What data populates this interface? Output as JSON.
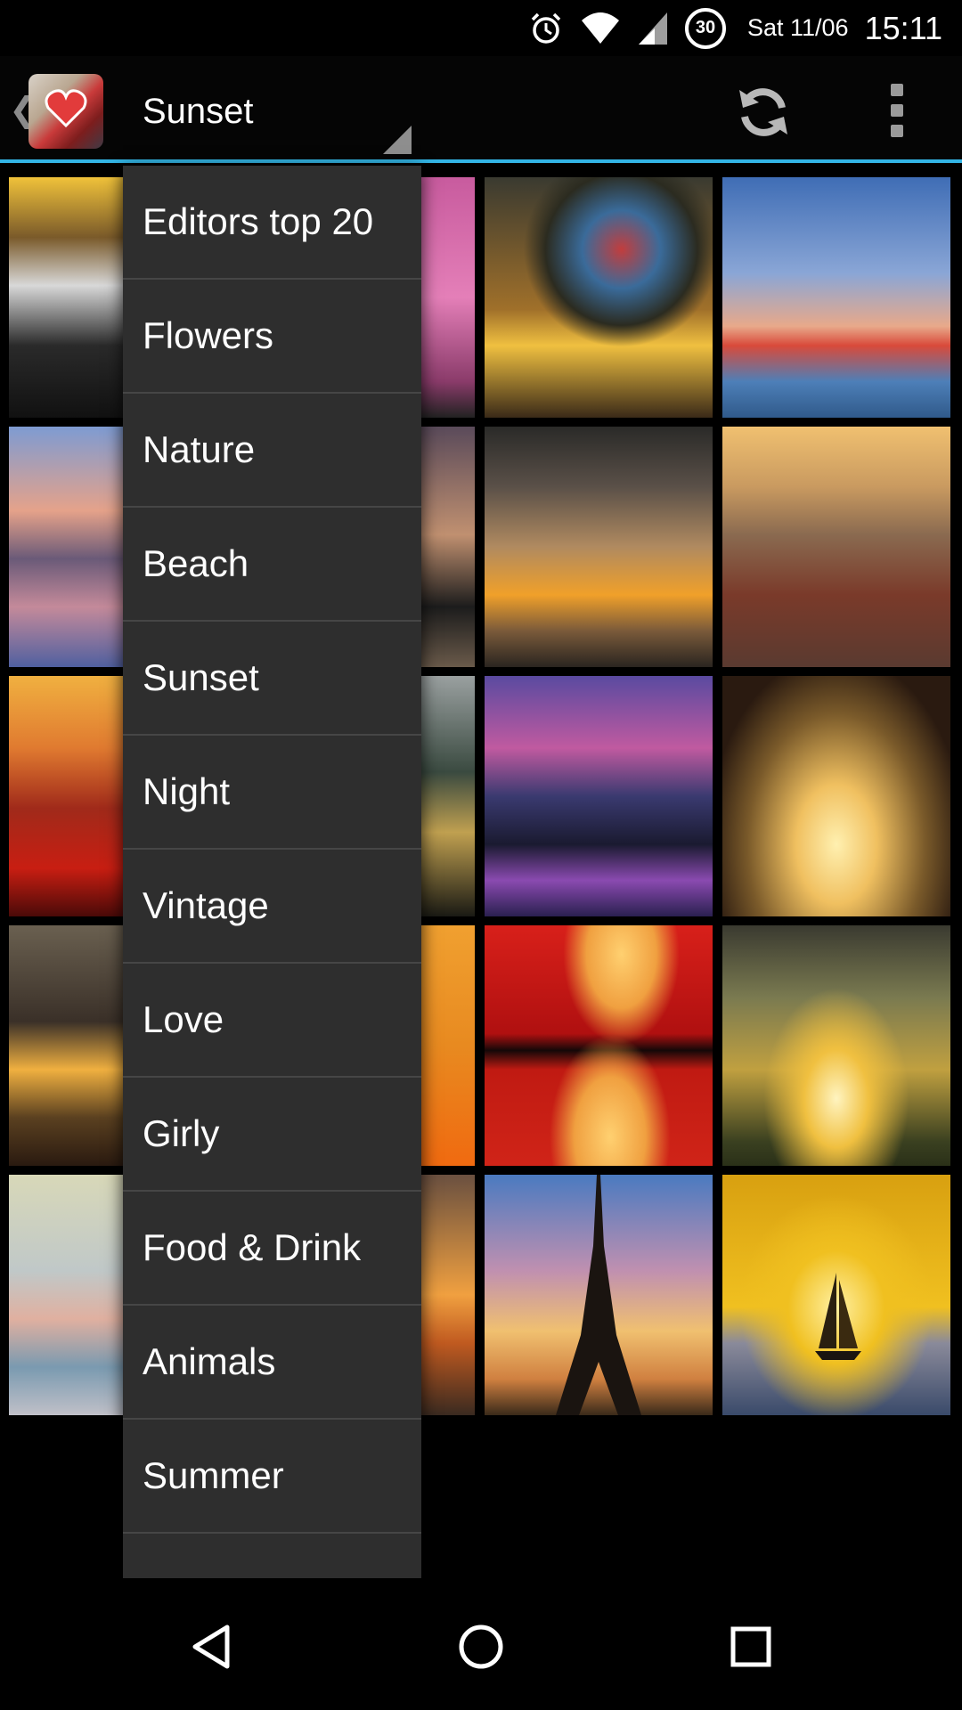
{
  "status_bar": {
    "date": "Sat 11/06",
    "time": "15:11",
    "badge": "30",
    "icons": [
      "alarm-icon",
      "wifi-icon",
      "signal-icon",
      "notification-badge"
    ]
  },
  "action_bar": {
    "spinner_label": "Sunset",
    "icons": [
      "back-caret-icon",
      "app-logo",
      "refresh-icon",
      "overflow-menu-icon"
    ],
    "accent_color": "#33b5e5"
  },
  "dropdown": {
    "items": [
      {
        "label": "Editors top 20"
      },
      {
        "label": "Flowers"
      },
      {
        "label": "Nature"
      },
      {
        "label": "Beach"
      },
      {
        "label": "Sunset"
      },
      {
        "label": "Night"
      },
      {
        "label": "Vintage"
      },
      {
        "label": "Love"
      },
      {
        "label": "Girly"
      },
      {
        "label": "Food & Drink"
      },
      {
        "label": "Animals"
      },
      {
        "label": "Summer"
      },
      {
        "label": ""
      }
    ]
  },
  "grid": {
    "tiles": [
      {
        "name": "harbor-town"
      },
      {
        "name": "pink-sky"
      },
      {
        "name": "balloon-sunset"
      },
      {
        "name": "palm-sunset"
      },
      {
        "name": "mountain-lake"
      },
      {
        "name": "dusk-trees"
      },
      {
        "name": "bridge-sunset"
      },
      {
        "name": "city-aerial"
      },
      {
        "name": "red-rock"
      },
      {
        "name": "cloudy-lake"
      },
      {
        "name": "night-city"
      },
      {
        "name": "tree-silhouette"
      },
      {
        "name": "skyscraper-road"
      },
      {
        "name": "orange-sky"
      },
      {
        "name": "red-sun"
      },
      {
        "name": "field-sunset"
      },
      {
        "name": "pastel-sea"
      },
      {
        "name": "sea-horizon"
      },
      {
        "name": "eiffel-tower"
      },
      {
        "name": "sailboat-sunset"
      }
    ]
  },
  "nav_bar": {
    "icons": [
      "back-icon",
      "home-icon",
      "recents-icon"
    ]
  }
}
